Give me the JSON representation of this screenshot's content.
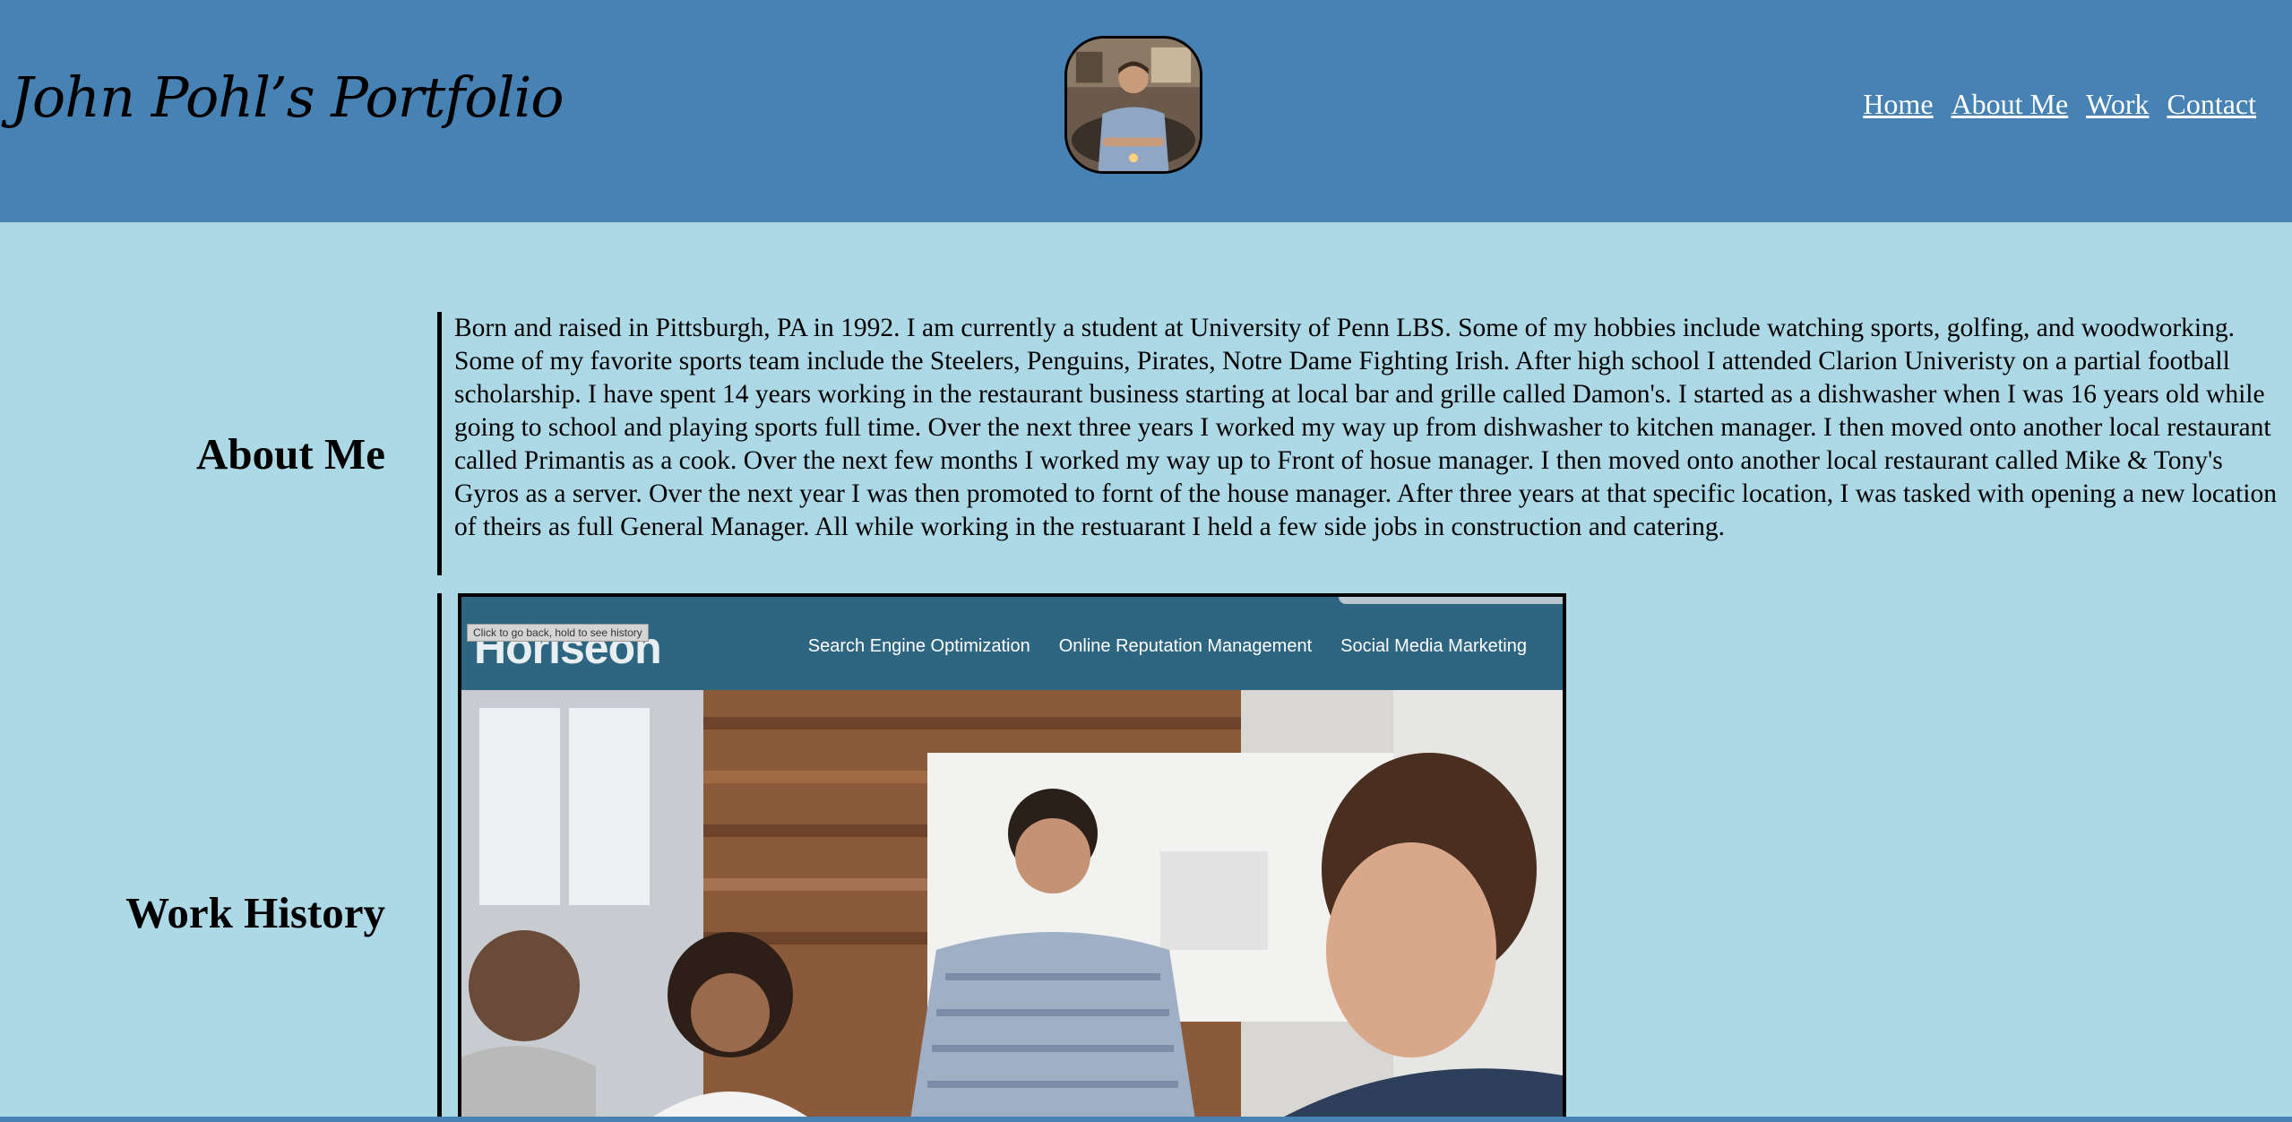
{
  "header": {
    "title": "John Pohl’s Portfolio",
    "avatar_alt": "Profile photo of John Pohl",
    "nav": [
      "Home",
      "About Me",
      "Work",
      "Contact"
    ]
  },
  "about": {
    "heading": "About Me",
    "text": "Born and raised in Pittsburgh, PA in 1992. I am currently a student at University of Penn LBS. Some of my hobbies include watching sports, golfing, and woodworking. Some of my favorite sports team include the Steelers, Penguins, Pirates, Notre Dame Fighting Irish. After high school I attended Clarion Univeristy on a partial football scholarship. I have spent 14 years working in the restaurant business starting at local bar and grille called Damon's. I started as a dishwasher when I was 16 years old while going to school and playing sports full time. Over the next three years I worked my way up from dishwasher to kitchen manager. I then moved onto another local restaurant called Primantis as a cook. Over the next few months I worked my way up to Front of hosue manager. I then moved onto another local restaurant called Mike & Tony's Gyros as a server. Over the next year I was then promoted to fornt of the house manager. After three years at that specific location, I was tasked with opening a new location of theirs as full General Manager. All while working in the restuarant I held a few side jobs in construction and catering."
  },
  "work": {
    "heading": "Work History",
    "project": {
      "logo": "Horiseon",
      "tooltip": "Click to go back, hold to see history",
      "menu": [
        "Search Engine Optimization",
        "Online Reputation Management",
        "Social Media Marketing"
      ]
    }
  },
  "colors": {
    "header_bg": "#4682b4",
    "page_bg": "#add8e6",
    "card_nav_bg": "#2e6682"
  }
}
